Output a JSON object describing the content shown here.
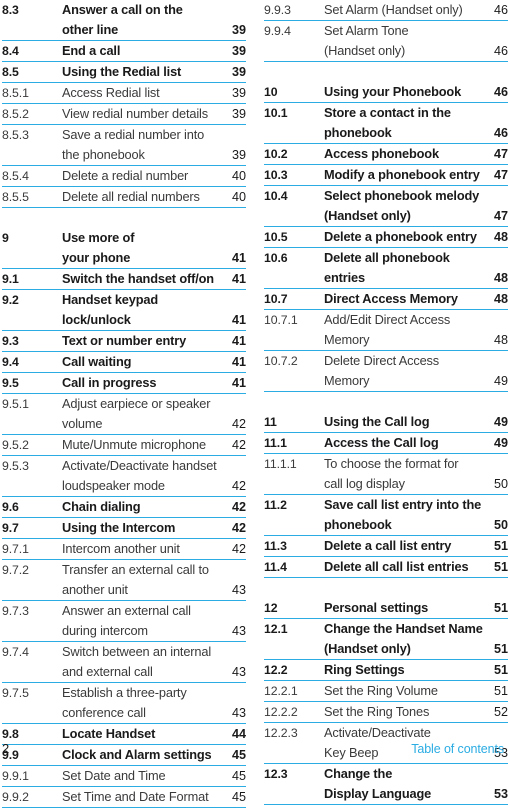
{
  "document": {
    "footer_label": "Table of contents",
    "folio": "2",
    "rule_color": "#2bace3",
    "text_color": "#1a1a1a"
  },
  "columns": [
    {
      "name": "left-column",
      "groups": [
        {
          "rows": [
            {
              "num": "8.3",
              "lines": [
                "Answer a call on the",
                "other line"
              ],
              "page": "39",
              "bold": true,
              "sub": false
            },
            {
              "num": "8.4",
              "lines": [
                "End a call"
              ],
              "page": "39",
              "bold": true,
              "sub": false
            },
            {
              "num": "8.5",
              "lines": [
                "Using the Redial list"
              ],
              "page": "39",
              "bold": true,
              "sub": false
            },
            {
              "num": "8.5.1",
              "lines": [
                "Access Redial list"
              ],
              "page": "39",
              "bold": false,
              "sub": true
            },
            {
              "num": "8.5.2",
              "lines": [
                "View redial number details"
              ],
              "page": "39",
              "bold": false,
              "sub": true
            },
            {
              "num": "8.5.3",
              "lines": [
                "Save a redial number into",
                "the phonebook"
              ],
              "page": "39",
              "bold": false,
              "sub": true
            },
            {
              "num": "8.5.4",
              "lines": [
                "Delete a redial number"
              ],
              "page": "40",
              "bold": false,
              "sub": true
            },
            {
              "num": "8.5.5",
              "lines": [
                "Delete all redial numbers"
              ],
              "page": "40",
              "bold": false,
              "sub": true
            }
          ]
        },
        {
          "rows": [
            {
              "num": "9",
              "lines": [
                "Use more of",
                "your phone"
              ],
              "page": "41",
              "bold": true,
              "sub": false
            },
            {
              "num": "9.1",
              "lines": [
                "Switch the handset off/on"
              ],
              "page": "41",
              "bold": true,
              "sub": false
            },
            {
              "num": "9.2",
              "lines": [
                "Handset keypad",
                "lock/unlock"
              ],
              "page": "41",
              "bold": true,
              "sub": false
            },
            {
              "num": "9.3",
              "lines": [
                "Text or number entry"
              ],
              "page": "41",
              "bold": true,
              "sub": false
            },
            {
              "num": "9.4",
              "lines": [
                "Call waiting"
              ],
              "page": "41",
              "bold": true,
              "sub": false
            },
            {
              "num": "9.5",
              "lines": [
                "Call in progress"
              ],
              "page": "41",
              "bold": true,
              "sub": false
            },
            {
              "num": "9.5.1",
              "lines": [
                "Adjust earpiece or speaker",
                "volume"
              ],
              "page": "42",
              "bold": false,
              "sub": true
            },
            {
              "num": "9.5.2",
              "lines": [
                "Mute/Unmute microphone"
              ],
              "page": "42",
              "bold": false,
              "sub": true
            },
            {
              "num": "9.5.3",
              "lines": [
                "Activate/Deactivate handset",
                "loudspeaker mode"
              ],
              "page": "42",
              "bold": false,
              "sub": true
            },
            {
              "num": "9.6",
              "lines": [
                "Chain dialing"
              ],
              "page": "42",
              "bold": true,
              "sub": false
            },
            {
              "num": "9.7",
              "lines": [
                "Using the Intercom"
              ],
              "page": "42",
              "bold": true,
              "sub": false
            },
            {
              "num": "9.7.1",
              "lines": [
                "Intercom another unit"
              ],
              "page": "42",
              "bold": false,
              "sub": true
            },
            {
              "num": "9.7.2",
              "lines": [
                "Transfer an external call to",
                "another unit"
              ],
              "page": "43",
              "bold": false,
              "sub": true
            },
            {
              "num": "9.7.3",
              "lines": [
                "Answer an external call",
                "during intercom"
              ],
              "page": "43",
              "bold": false,
              "sub": true
            },
            {
              "num": "9.7.4",
              "lines": [
                "Switch between an internal",
                "and external call"
              ],
              "page": "43",
              "bold": false,
              "sub": true
            },
            {
              "num": "9.7.5",
              "lines": [
                "Establish a three-party",
                "conference call"
              ],
              "page": "43",
              "bold": false,
              "sub": true
            },
            {
              "num": "9.8",
              "lines": [
                "Locate Handset"
              ],
              "page": "44",
              "bold": true,
              "sub": false
            },
            {
              "num": "9.9",
              "lines": [
                "Clock and Alarm settings"
              ],
              "page": "45",
              "bold": true,
              "sub": false
            },
            {
              "num": "9.9.1",
              "lines": [
                "Set Date and Time"
              ],
              "page": "45",
              "bold": false,
              "sub": true
            },
            {
              "num": "9.9.2",
              "lines": [
                "Set Time and Date Format"
              ],
              "page": "45",
              "bold": false,
              "sub": true
            }
          ]
        }
      ]
    },
    {
      "name": "right-column",
      "groups": [
        {
          "rows": [
            {
              "num": "9.9.3",
              "lines": [
                "Set Alarm (Handset only)"
              ],
              "page": "46",
              "bold": false,
              "sub": true
            },
            {
              "num": "9.9.4",
              "lines": [
                "Set Alarm Tone",
                "(Handset only)"
              ],
              "page": "46",
              "bold": false,
              "sub": true
            }
          ]
        },
        {
          "rows": [
            {
              "num": "10",
              "lines": [
                "Using your Phonebook"
              ],
              "page": "46",
              "bold": true,
              "sub": false
            },
            {
              "num": "10.1",
              "lines": [
                "Store a contact in the",
                "phonebook"
              ],
              "page": "46",
              "bold": true,
              "sub": false
            },
            {
              "num": "10.2",
              "lines": [
                "Access phonebook"
              ],
              "page": "47",
              "bold": true,
              "sub": false
            },
            {
              "num": "10.3",
              "lines": [
                "Modify a phonebook entry"
              ],
              "page": "47",
              "bold": true,
              "sub": false
            },
            {
              "num": "10.4",
              "lines": [
                "Select phonebook melody",
                "(Handset only)"
              ],
              "page": "47",
              "bold": true,
              "sub": false
            },
            {
              "num": "10.5",
              "lines": [
                "Delete a phonebook entry"
              ],
              "page": "48",
              "bold": true,
              "sub": false
            },
            {
              "num": "10.6",
              "lines": [
                "Delete all phonebook",
                "entries"
              ],
              "page": "48",
              "bold": true,
              "sub": false
            },
            {
              "num": "10.7",
              "lines": [
                "Direct Access Memory"
              ],
              "page": "48",
              "bold": true,
              "sub": false
            },
            {
              "num": "10.7.1",
              "lines": [
                "Add/Edit Direct Access",
                "Memory"
              ],
              "page": "48",
              "bold": false,
              "sub": true
            },
            {
              "num": "10.7.2",
              "lines": [
                "Delete Direct Access",
                "Memory"
              ],
              "page": "49",
              "bold": false,
              "sub": true
            }
          ]
        },
        {
          "rows": [
            {
              "num": "11",
              "lines": [
                "Using the Call log"
              ],
              "page": "49",
              "bold": true,
              "sub": false
            },
            {
              "num": "11.1",
              "lines": [
                "Access the Call log"
              ],
              "page": "49",
              "bold": true,
              "sub": false
            },
            {
              "num": "11.1.1",
              "lines": [
                "To choose the format for",
                "call log display"
              ],
              "page": "50",
              "bold": false,
              "sub": true
            },
            {
              "num": "11.2",
              "lines": [
                "Save call list entry into the",
                "phonebook"
              ],
              "page": "50",
              "bold": true,
              "sub": false
            },
            {
              "num": "11.3",
              "lines": [
                "Delete a call list entry"
              ],
              "page": "51",
              "bold": true,
              "sub": false
            },
            {
              "num": "11.4",
              "lines": [
                "Delete all call list entries"
              ],
              "page": "51",
              "bold": true,
              "sub": false
            }
          ]
        },
        {
          "rows": [
            {
              "num": "12",
              "lines": [
                "Personal settings"
              ],
              "page": "51",
              "bold": true,
              "sub": false
            },
            {
              "num": "12.1",
              "lines": [
                "Change the Handset Name",
                "(Handset only)"
              ],
              "page": "51",
              "bold": true,
              "sub": false
            },
            {
              "num": "12.2",
              "lines": [
                "Ring Settings"
              ],
              "page": "51",
              "bold": true,
              "sub": false
            },
            {
              "num": "12.2.1",
              "lines": [
                "Set the Ring Volume"
              ],
              "page": "51",
              "bold": false,
              "sub": true
            },
            {
              "num": "12.2.2",
              "lines": [
                "Set the Ring Tones"
              ],
              "page": "52",
              "bold": false,
              "sub": true
            },
            {
              "num": "12.2.3",
              "lines": [
                "Activate/Deactivate",
                "Key Beep"
              ],
              "page": "53",
              "bold": false,
              "sub": true
            },
            {
              "num": "12.3",
              "lines": [
                "Change the",
                "Display Language"
              ],
              "page": "53",
              "bold": true,
              "sub": false
            }
          ]
        }
      ]
    }
  ]
}
